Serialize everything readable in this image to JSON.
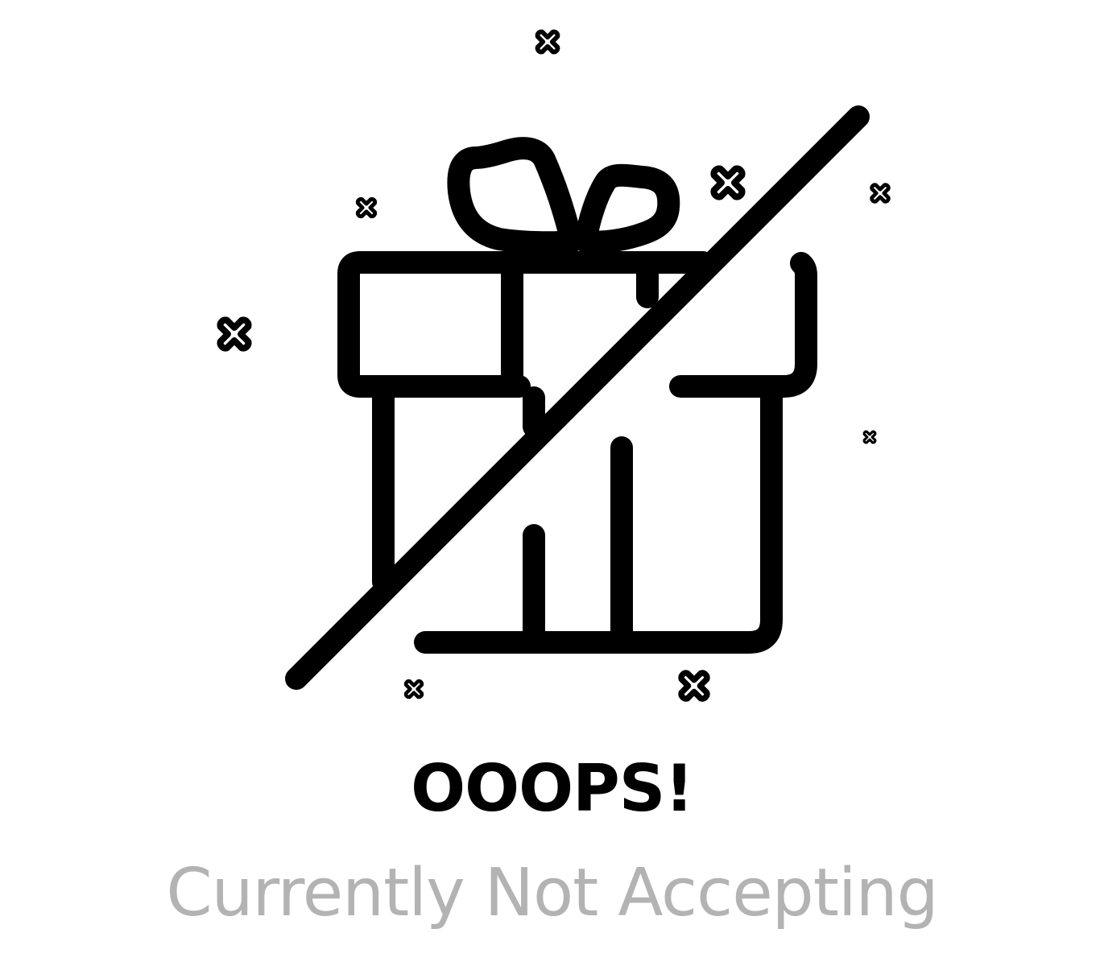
{
  "headline": "OOOPS!",
  "message": "Currently Not Accepting",
  "colors": {
    "background": "#ffffff",
    "icon": "#000000",
    "headline": "#000000",
    "message": "#b3b3b3"
  },
  "illustration": {
    "icon": "gift-crossed-out-icon",
    "decoration": "sparkle-cross-icon"
  }
}
